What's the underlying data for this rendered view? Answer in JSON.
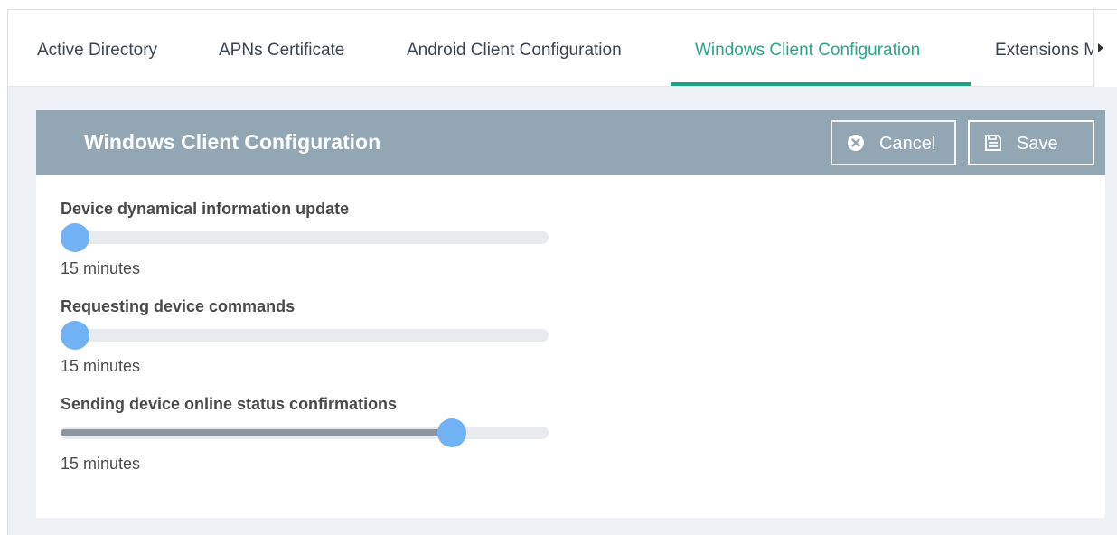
{
  "tabs": [
    {
      "label": "Active Directory"
    },
    {
      "label": "APNs Certificate"
    },
    {
      "label": "Android Client Configuration"
    },
    {
      "label": "Windows Client Configuration",
      "active": true
    },
    {
      "label": "Extensions M"
    }
  ],
  "panel": {
    "title": "Windows Client Configuration",
    "cancel_label": "Cancel",
    "save_label": "Save"
  },
  "settings": [
    {
      "label": "Device dynamical information update",
      "value_text": "15 minutes",
      "slider_fraction": 0.0
    },
    {
      "label": "Requesting device commands",
      "value_text": "15 minutes",
      "slider_fraction": 0.0
    },
    {
      "label": "Sending device online status confirmations",
      "value_text": "15 minutes",
      "slider_fraction": 0.82
    }
  ],
  "colors": {
    "accent": "#1fa384",
    "header_bg": "#93a6b4",
    "slider_thumb": "#70b2f3"
  }
}
